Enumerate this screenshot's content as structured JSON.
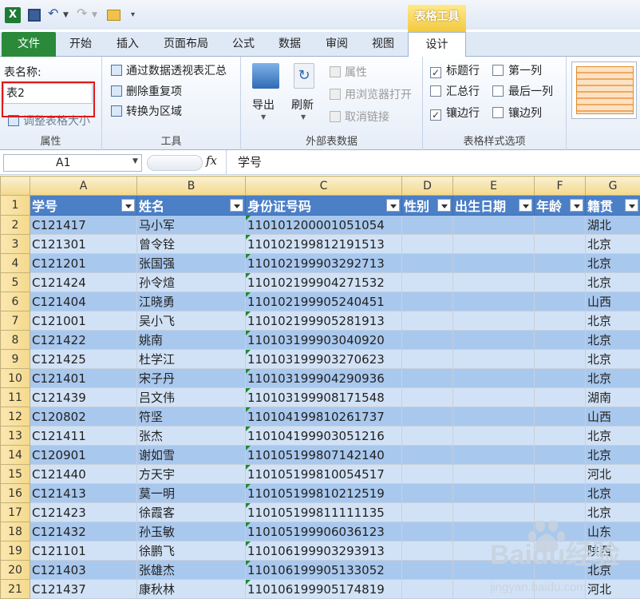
{
  "ribbon_tabs": [
    "文件",
    "开始",
    "插入",
    "页面布局",
    "公式",
    "数据",
    "审阅",
    "视图",
    "设计"
  ],
  "context_title": "表格工具",
  "properties": {
    "name_label": "表名称:",
    "name_value": "表2",
    "resize": "调整表格大小",
    "title": "属性"
  },
  "tools": {
    "pivot": "通过数据透视表汇总",
    "dedupe": "删除重复项",
    "convert": "转换为区域",
    "title": "工具"
  },
  "external": {
    "export": "导出",
    "refresh": "刷新",
    "props": "属性",
    "browser": "用浏览器打开",
    "unlink": "取消链接",
    "title": "外部表数据"
  },
  "style_options": {
    "header_row": "标题行",
    "total_row": "汇总行",
    "banded_rows": "镶边行",
    "first_col": "第一列",
    "last_col": "最后一列",
    "banded_cols": "镶边列",
    "title": "表格样式选项",
    "checks": {
      "header_row": true,
      "total_row": false,
      "banded_rows": true,
      "first_col": false,
      "last_col": false,
      "banded_cols": false
    }
  },
  "formula_bar": {
    "cell": "A1",
    "fx": "fx",
    "value": "学号"
  },
  "columns": [
    "A",
    "B",
    "C",
    "D",
    "E",
    "F",
    "G"
  ],
  "headers": [
    "学号",
    "姓名",
    "身份证号码",
    "性别",
    "出生日期",
    "年龄",
    "籍贯"
  ],
  "rows": [
    [
      "C121417",
      "马小军",
      "110101200001051054",
      "",
      "",
      "",
      "湖北"
    ],
    [
      "C121301",
      "曾令铨",
      "110102199812191513",
      "",
      "",
      "",
      "北京"
    ],
    [
      "C121201",
      "张国强",
      "110102199903292713",
      "",
      "",
      "",
      "北京"
    ],
    [
      "C121424",
      "孙令煊",
      "110102199904271532",
      "",
      "",
      "",
      "北京"
    ],
    [
      "C121404",
      "江晓勇",
      "110102199905240451",
      "",
      "",
      "",
      "山西"
    ],
    [
      "C121001",
      "吴小飞",
      "110102199905281913",
      "",
      "",
      "",
      "北京"
    ],
    [
      "C121422",
      "姚南",
      "110103199903040920",
      "",
      "",
      "",
      "北京"
    ],
    [
      "C121425",
      "杜学江",
      "110103199903270623",
      "",
      "",
      "",
      "北京"
    ],
    [
      "C121401",
      "宋子丹",
      "110103199904290936",
      "",
      "",
      "",
      "北京"
    ],
    [
      "C121439",
      "吕文伟",
      "110103199908171548",
      "",
      "",
      "",
      "湖南"
    ],
    [
      "C120802",
      "符坚",
      "110104199810261737",
      "",
      "",
      "",
      "山西"
    ],
    [
      "C121411",
      "张杰",
      "110104199903051216",
      "",
      "",
      "",
      "北京"
    ],
    [
      "C120901",
      "谢如雪",
      "110105199807142140",
      "",
      "",
      "",
      "北京"
    ],
    [
      "C121440",
      "方天宇",
      "110105199810054517",
      "",
      "",
      "",
      "河北"
    ],
    [
      "C121413",
      "莫一明",
      "110105199810212519",
      "",
      "",
      "",
      "北京"
    ],
    [
      "C121423",
      "徐霞客",
      "110105199811111135",
      "",
      "",
      "",
      "北京"
    ],
    [
      "C121432",
      "孙玉敏",
      "110105199906036123",
      "",
      "",
      "",
      "山东"
    ],
    [
      "C121101",
      "徐鹏飞",
      "110106199903293913",
      "",
      "",
      "",
      "陕西"
    ],
    [
      "C121403",
      "张雄杰",
      "110106199905133052",
      "",
      "",
      "",
      "北京"
    ],
    [
      "C121437",
      "康秋林",
      "110106199905174819",
      "",
      "",
      "",
      "河北"
    ]
  ],
  "watermark": {
    "brand": "Baidu经验",
    "url": "jingyan.baidu.com"
  },
  "colors": {
    "header_fill": "#4b7fc6",
    "band_dark": "#a9c8ee",
    "band_light": "#d2e2f6",
    "highlight": "#e01818"
  }
}
